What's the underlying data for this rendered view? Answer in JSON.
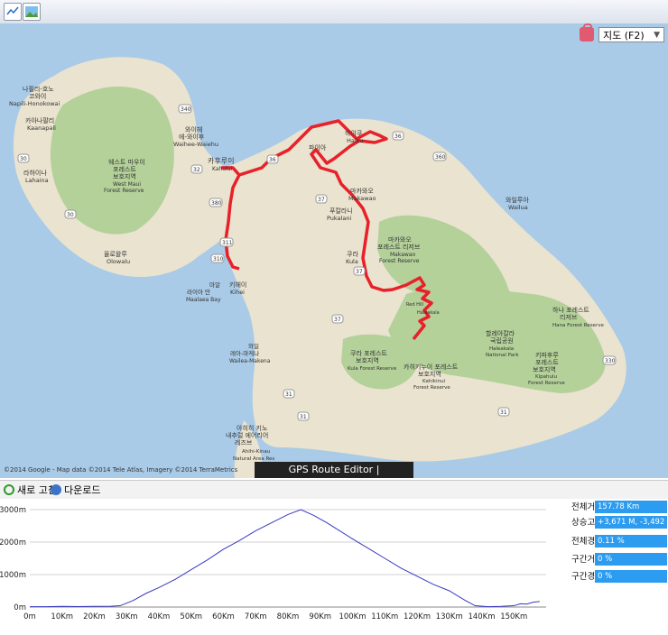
{
  "toolbar": {
    "map_type_label": "지도 (F2)"
  },
  "map": {
    "banner": "GPS Route Editor | www.gpsnote.net",
    "copyright": "©2014 Google - Map data ©2014 Tele Atlas, Imagery ©2014 TerraMetrics",
    "labels": {
      "napili_kr": "나필리-호노",
      "napili_kr2": "코와이",
      "napili": "Napili-Honokowai",
      "kaanapali_kr": "카아나팔리",
      "kaanapali": "Kaanapali",
      "waihee_kr": "와이헤",
      "waihee_kr2": "에-와이후",
      "waihee": "Waihee-Waiehu",
      "lahaina_kr": "라하이나",
      "lahaina": "Lahaina",
      "westmaui_kr": "웨스트 마우이",
      "westmaui_kr2": "포레스트",
      "westmaui_kr3": "보호지역",
      "westmaui": "West Maui",
      "westmaui2": "Forest Reserve",
      "kahului_kr": "카후루이",
      "kahului": "Kahului",
      "paia_kr": "파이아",
      "haiku_kr": "하이쿠",
      "haiku": "Haiku",
      "makawao_kr": "마카와오",
      "makawao": "Makawao",
      "pukalani_kr": "푸칼라니",
      "pukalani": "Pukalani",
      "makawao_fr_kr": "마카와오",
      "makawao_fr_kr2": "포레스트 리저브",
      "makawao_fr": "Makawao",
      "makawao_fr2": "Forest Reserve",
      "kula_kr": "쿠라",
      "kula": "Kula",
      "wailua_kr": "와일루아",
      "wailua": "Wailua",
      "olowalu_kr": "올로왈루",
      "olowalu": "Olowalu",
      "maalaea_kr": "마알",
      "maalaea_kr2": "라이아 만",
      "maalaea": "Maalaea Bay",
      "kihei_kr": "키헤이",
      "kihei": "Kihei",
      "wailea_kr": "와일",
      "wailea_kr2": "레아-마케나",
      "wailea": "Wailea-Makena",
      "kulafr_kr": "쿠라 포레스트",
      "kulafr_kr2": "보호지역",
      "kulafr": "Kula Forest Reserve",
      "kahikinui_kr": "카히키누이 포레스트",
      "kahikinui_kr2": "보호지역",
      "kahikinui": "Kahikinui",
      "kahikinui2": "Forest Reserve",
      "haleakala_kr": "할레아칼라",
      "haleakala_kr2": "국립공원",
      "haleakala": "Haleakala",
      "haleakala2": "National Park",
      "hana_kr": "하나 포레스트",
      "hana_kr2": "리저브",
      "hana": "Hana Forest Reserve",
      "kipahulu_kr": "키파후루",
      "kipahulu_kr2": "포레스트",
      "kipahulu_kr3": "보호지역",
      "kipahulu": "Kipahulu",
      "kipahulu2": "Forest Reserve",
      "ahihi_kr": "아히히 키노",
      "ahihi_kr2": "내추럴 에어리어",
      "ahihi_kr3": "레즈브",
      "ahihi": "Ahihi-Kinau",
      "ahihi2": "Natural Area Res",
      "redhill": "Red Hill",
      "haleakala_summit": "Haleakala"
    },
    "road_numbers": [
      "340",
      "30",
      "30",
      "32",
      "380",
      "36",
      "360",
      "37",
      "311",
      "310",
      "37",
      "31",
      "31",
      "37",
      "330",
      "31",
      "36"
    ]
  },
  "bottom_bar": {
    "refresh_label": "새로 고침",
    "download_label": "다운로드"
  },
  "chart_data": {
    "type": "line",
    "title": "",
    "xlabel": "",
    "ylabel": "",
    "x_ticks": [
      "0m",
      "10Km",
      "20Km",
      "30Km",
      "40Km",
      "50Km",
      "60Km",
      "70Km",
      "80Km",
      "90Km",
      "100Km",
      "110Km",
      "120Km",
      "130Km",
      "140Km",
      "150Km"
    ],
    "y_ticks": [
      "0m",
      "1000m",
      "2000m",
      "3000m"
    ],
    "xlim": [
      0,
      160
    ],
    "ylim": [
      0,
      3000
    ],
    "x": [
      0,
      5,
      10,
      15,
      20,
      25,
      28,
      32,
      36,
      40,
      45,
      50,
      55,
      60,
      65,
      70,
      75,
      80,
      84,
      88,
      92,
      96,
      100,
      105,
      110,
      115,
      120,
      125,
      130,
      135,
      138,
      142,
      146,
      150,
      152,
      154,
      156,
      158
    ],
    "values": [
      10,
      12,
      20,
      15,
      20,
      25,
      40,
      200,
      420,
      600,
      850,
      1150,
      1450,
      1780,
      2050,
      2350,
      2600,
      2850,
      3000,
      2820,
      2600,
      2350,
      2100,
      1800,
      1500,
      1200,
      950,
      700,
      500,
      200,
      40,
      10,
      20,
      40,
      100,
      90,
      150,
      170
    ]
  },
  "stats": [
    {
      "label": "전체거리",
      "value": "157.78 Km"
    },
    {
      "label": "상승고도",
      "value": "+3,671 M, -3,492 M"
    },
    {
      "label": "전체경사",
      "value": "0.11 %"
    },
    {
      "label": "구간거리",
      "value": "0 %"
    },
    {
      "label": "구간경사",
      "value": "0 %"
    }
  ],
  "colors": {
    "route": "#e8202a",
    "water": "#a9cbe8",
    "land": "#eae3cf",
    "forest": "#b4d19a",
    "profile_line": "#3838c0",
    "stat_bg": "#2c9cf0"
  }
}
